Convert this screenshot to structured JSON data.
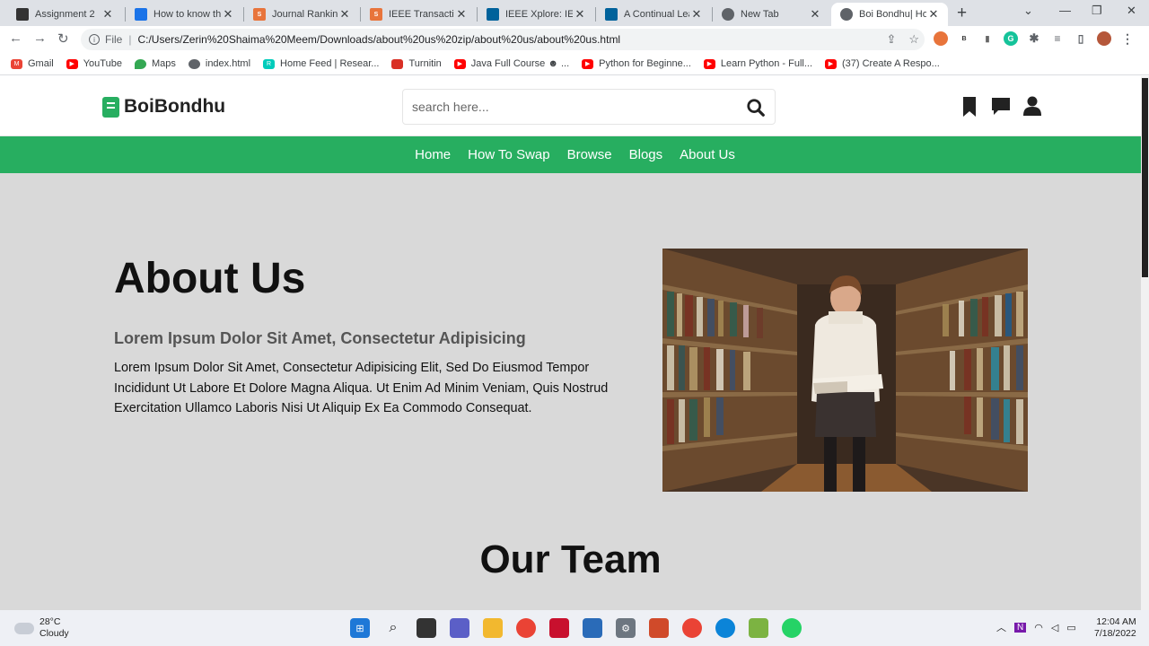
{
  "browser": {
    "tabs": [
      {
        "label": "Assignment 2",
        "icon": "document-icon",
        "color": "#333"
      },
      {
        "label": "How to know the",
        "icon": "google-drive-icon",
        "color": "#1a73e8"
      },
      {
        "label": "Journal Rankings",
        "icon": "sjr-icon",
        "color": "#e8743b"
      },
      {
        "label": "IEEE Transactions",
        "icon": "sjr-icon",
        "color": "#e8743b"
      },
      {
        "label": "IEEE Xplore: IEEE",
        "icon": "ieee-icon",
        "color": "#00629b"
      },
      {
        "label": "A Continual Learn",
        "icon": "ieee-icon",
        "color": "#00629b"
      },
      {
        "label": "New Tab",
        "icon": "chrome-icon",
        "color": "#5f6368"
      },
      {
        "label": "Boi Bondhu| Hom",
        "icon": "globe-icon",
        "color": "#5f6368",
        "active": true
      }
    ],
    "address": {
      "scheme": "File",
      "url": "C:/Users/Zerin%20Shaima%20Meem/Downloads/about%20us%20zip/about%20us/about%20us.html"
    },
    "bookmarks": [
      {
        "label": "Gmail",
        "icon": "gmail-icon",
        "color": "#ea4335"
      },
      {
        "label": "YouTube",
        "icon": "youtube-icon",
        "color": "#ff0000"
      },
      {
        "label": "Maps",
        "icon": "maps-icon",
        "color": "#34a853"
      },
      {
        "label": "index.html",
        "icon": "globe-icon",
        "color": "#5f6368"
      },
      {
        "label": "Home Feed | Resear...",
        "icon": "researchgate-icon",
        "color": "#00ccbb"
      },
      {
        "label": "Turnitin",
        "icon": "turnitin-icon",
        "color": "#d93025"
      },
      {
        "label": "Java Full Course ☻ ...",
        "icon": "youtube-icon",
        "color": "#ff0000"
      },
      {
        "label": "Python for Beginne...",
        "icon": "youtube-icon",
        "color": "#ff0000"
      },
      {
        "label": "Learn Python - Full...",
        "icon": "youtube-icon",
        "color": "#ff0000"
      },
      {
        "label": "(37) Create A Respo...",
        "icon": "youtube-icon",
        "color": "#ff0000"
      }
    ]
  },
  "site": {
    "brand": "BoiBondhu",
    "accent": "#27ae60",
    "search_placeholder": "search here...",
    "nav": [
      "Home",
      "How To Swap",
      "Browse",
      "Blogs",
      "About Us"
    ]
  },
  "about": {
    "title": "About Us",
    "subtitle": "Lorem Ipsum Dolor Sit Amet, Consectetur Adipisicing",
    "body": "Lorem Ipsum Dolor Sit Amet, Consectetur Adipisicing Elit, Sed Do Eiusmod Tempor Incididunt Ut Labore Et Dolore Magna Aliqua. Ut Enim Ad Minim Veniam, Quis Nostrud Exercitation Ullamco Laboris Nisi Ut Aliquip Ex Ea Commodo Consequat."
  },
  "team": {
    "title": "Our Team"
  },
  "taskbar": {
    "temp": "28°C",
    "condition": "Cloudy",
    "time": "12:04 AM",
    "date": "7/18/2022"
  }
}
